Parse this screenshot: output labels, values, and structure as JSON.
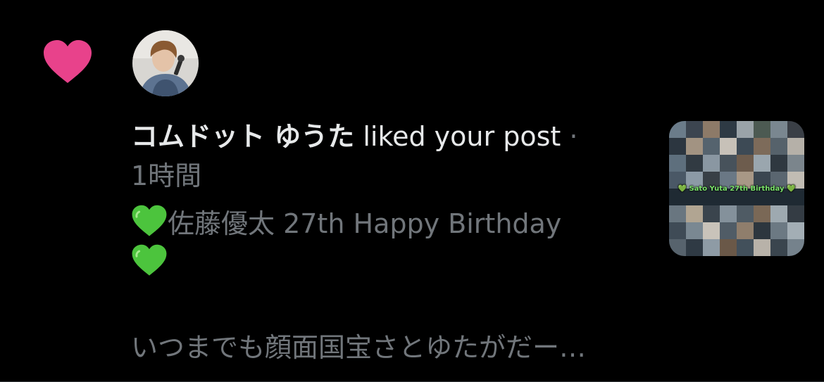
{
  "notification": {
    "type_icon": "heart-icon",
    "accent_color": "#e8428b",
    "user_name": "コムドット ゆうた",
    "action": "liked your post",
    "separator": "·",
    "time": "1時間",
    "post_text_line1": "佐藤優太 27th Happy Birthday",
    "post_emoji": "green-heart-icon",
    "post_text_body": "いつまでも顔面国宝さとゆたがだー…",
    "thumbnail_banner": "💚 Sato Yuta 27th Birthday 💚",
    "thumbnail_icon": "collage-thumbnail"
  }
}
